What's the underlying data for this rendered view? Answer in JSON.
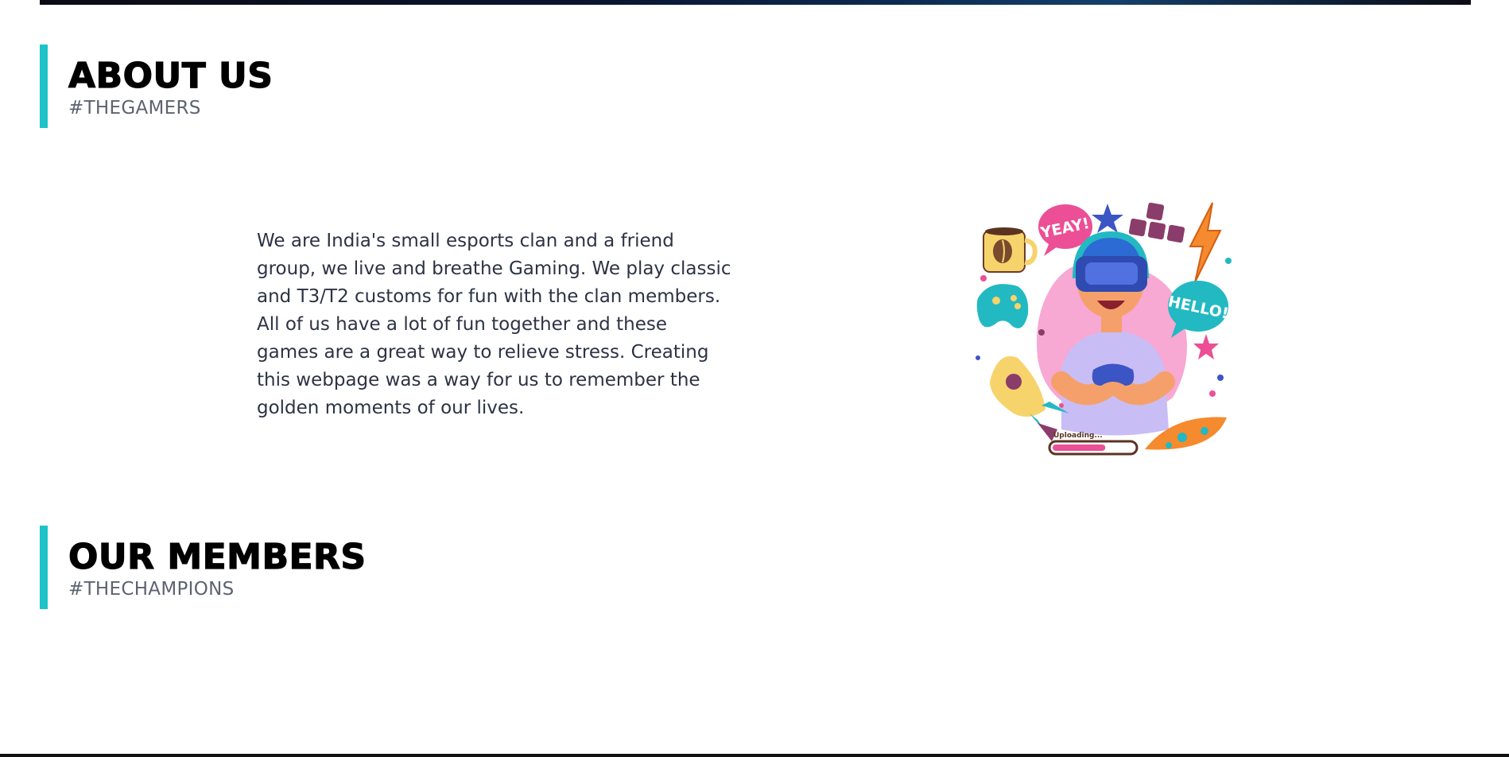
{
  "about": {
    "title": "ABOUT US",
    "subtitle": "#THEGAMERS",
    "text": "We are India's small esports clan and a friend group, we live and breathe Gaming. We play classic and T3/T2 customs for fun with the clan members. All of us have a lot of fun together and these games are a great way to relieve stress. Creating this webpage was a way for us to remember the golden moments of our lives."
  },
  "illustration": {
    "icon": "vr-gamer-illustration",
    "bubble_left": "YEAY!",
    "bubble_right": "HELLO!",
    "progress_label": "Uploading...",
    "progress": 0.65
  },
  "members": {
    "title": "OUR MEMBERS",
    "subtitle": "#THECHAMPIONS"
  },
  "colors": {
    "accent": "#1fc3c7",
    "title": "#000000",
    "subtitle": "#5c6470",
    "body_text": "#2c3344"
  }
}
